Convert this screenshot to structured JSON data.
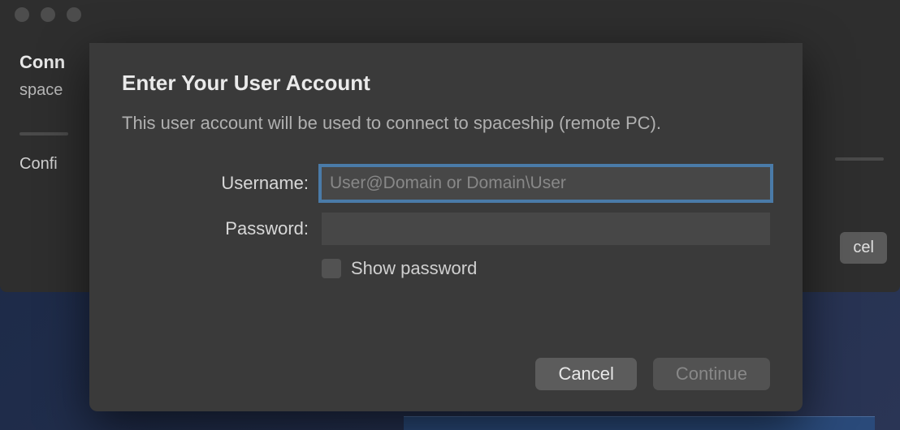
{
  "background": {
    "title_partial": "Conn",
    "subtitle_partial": "space",
    "config_partial": "Confi",
    "cancel_partial": "cel"
  },
  "modal": {
    "title": "Enter Your User Account",
    "description": "This user account will be used to connect to spaceship (remote PC).",
    "username_label": "Username:",
    "username_placeholder": "User@Domain or Domain\\User",
    "username_value": "",
    "password_label": "Password:",
    "password_value": "",
    "show_password_label": "Show password",
    "show_password_checked": false,
    "cancel_button": "Cancel",
    "continue_button": "Continue"
  }
}
